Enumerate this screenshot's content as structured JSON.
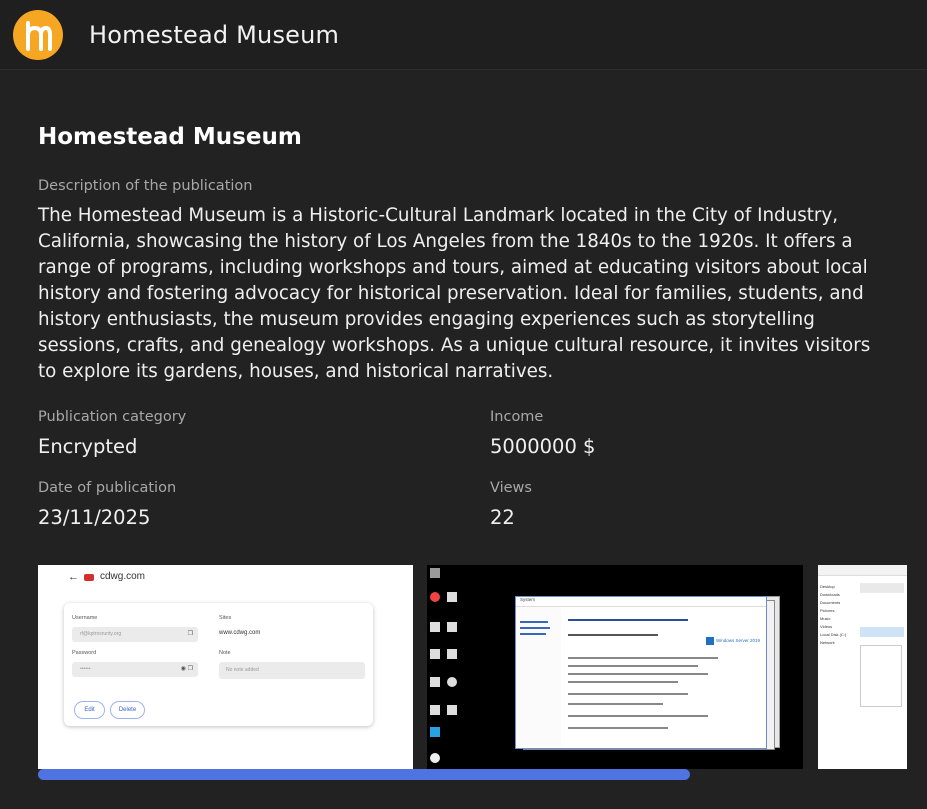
{
  "header": {
    "app_title": "Homestead Museum",
    "logo_icon": "homestead-logo-icon"
  },
  "publication": {
    "title": "Homestead Museum",
    "description_label": "Description of the publication",
    "description": "The Homestead Museum is a Historic-Cultural Landmark located in the City of Industry, California, showcasing the history of Los Angeles from the 1840s to the 1920s. It offers a range of programs, including workshops and tours, aimed at educating visitors about local history and fostering advocacy for historical preservation. Ideal for families, students, and history enthusiasts, the museum provides engaging experiences such as storytelling sessions, crafts, and genealogy workshops. As a unique cultural resource, it invites visitors to explore its gardens, houses, and historical narratives.",
    "category_label": "Publication category",
    "category": "Encrypted",
    "income_label": "Income",
    "income": "5000000 $",
    "date_label": "Date of publication",
    "date": "23/11/2025",
    "views_label": "Views",
    "views": "22"
  },
  "gallery": {
    "shot1": {
      "site": "cdwg.com",
      "username_label": "Username",
      "username_value": "rf@kptrnsrunty.org",
      "sites_label": "Sites",
      "sites_value": "www.cdwg.com",
      "password_label": "Password",
      "password_value": "••••••",
      "note_label": "Note",
      "note_placeholder": "No note added",
      "edit_label": "Edit",
      "delete_label": "Delete"
    },
    "shot2": {
      "window_title": "System",
      "edition_label": "Windows Server 2019"
    },
    "shot3": {
      "tree_items": [
        "Desktop",
        "Downloads",
        "Documents",
        "Pictures",
        "Music",
        "Videos",
        "Local Disk (C:)",
        "Network"
      ]
    }
  },
  "colors": {
    "accent": "#4f73e0",
    "logo": "#f5a623",
    "background": "#222223"
  }
}
